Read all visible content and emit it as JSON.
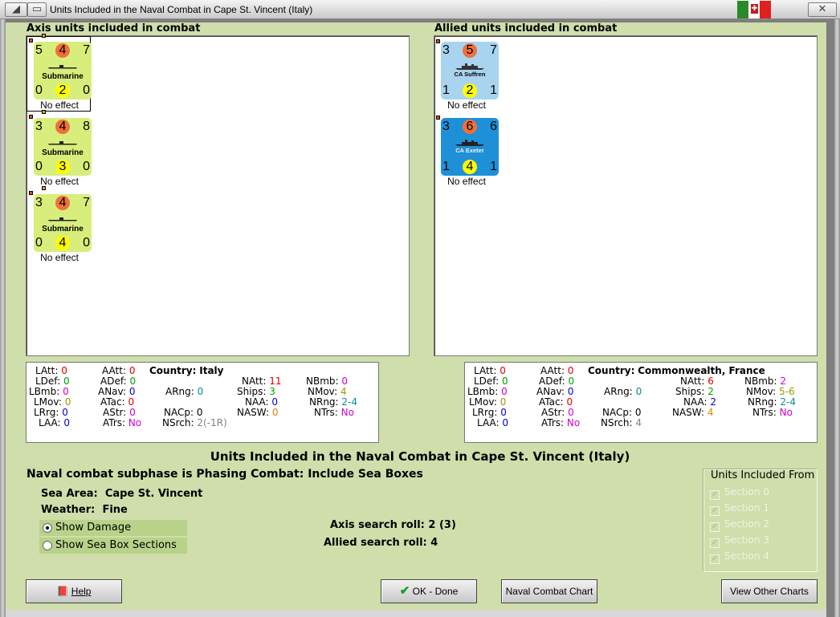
{
  "window": {
    "title": "Units Included in the Naval Combat in Cape St. Vincent (Italy)",
    "flag_colors": [
      "#2a8a2a",
      "#ffffff",
      "#e02020"
    ],
    "close_glyph": "✕"
  },
  "axis": {
    "heading": "Axis units included in combat",
    "units": [
      {
        "name": "Submarine",
        "tl": "5",
        "tc": "4",
        "tr": "7",
        "bl": "0",
        "bc": "2",
        "br": "0",
        "effect": "No effect",
        "color": "#d7ee7c"
      },
      {
        "name": "Submarine",
        "tl": "3",
        "tc": "4",
        "tr": "8",
        "bl": "0",
        "bc": "3",
        "br": "0",
        "effect": "No effect",
        "color": "#d7ee7c"
      },
      {
        "name": "Submarine",
        "tl": "3",
        "tc": "4",
        "tr": "7",
        "bl": "0",
        "bc": "4",
        "br": "0",
        "effect": "No effect",
        "color": "#d7ee7c"
      }
    ],
    "stats": {
      "country_label": "Country:",
      "country": "Italy",
      "LAtt": "0",
      "LDef": "0",
      "LBmb": "0",
      "LMov": "0",
      "LRrg": "0",
      "LAA": "0",
      "AAtt": "0",
      "ADef": "0",
      "ANav": "0",
      "ATac": "0",
      "AStr": "0",
      "ATrs": "No",
      "ARng": "0",
      "NACp": "0",
      "NAtt": "11",
      "Ships": "3",
      "NAA": "0",
      "NASW": "0",
      "NSrch": "2(-1R)",
      "NBmb": "0",
      "NMov": "4",
      "NRng": "2-4",
      "NTrs": "No"
    }
  },
  "allied": {
    "heading": "Allied units included in combat",
    "units": [
      {
        "name": "CA Suffren",
        "tl": "3",
        "tc": "5",
        "tr": "7",
        "bl": "1",
        "bc": "2",
        "br": "1",
        "effect": "No effect",
        "color": "#a8d4f0"
      },
      {
        "name": "CA Exeter",
        "tl": "3",
        "tc": "6",
        "tr": "6",
        "bl": "1",
        "bc": "4",
        "br": "1",
        "effect": "No effect",
        "color": "#1e90d8"
      }
    ],
    "stats": {
      "country_label": "Country:",
      "country": "Commonwealth, France",
      "LAtt": "0",
      "LDef": "0",
      "LBmb": "0",
      "LMov": "0",
      "LRrg": "0",
      "LAA": "0",
      "AAtt": "0",
      "ADef": "0",
      "ANav": "0",
      "ATac": "0",
      "AStr": "0",
      "ATrs": "No",
      "ARng": "0",
      "NACp": "0",
      "NAtt": "6",
      "Ships": "2",
      "NAA": "2",
      "NASW": "4",
      "NSrch": "4",
      "NBmb": "2",
      "NMov": "5-6",
      "NRng": "2-4",
      "NTrs": "No"
    }
  },
  "summary": {
    "title": "Units Included in the Naval Combat in Cape St. Vincent (Italy)",
    "subphase": "Naval combat subphase is Phasing Combat: Include Sea Boxes",
    "sea_area_label": "Sea Area:",
    "sea_area": "Cape St. Vincent",
    "weather_label": "Weather:",
    "weather": "Fine",
    "show_damage": "Show Damage",
    "show_sections": "Show Sea Box Sections",
    "axis_roll_label": "Axis search roll:",
    "axis_roll": "2 (3)",
    "allied_roll_label": "Allied search roll:",
    "allied_roll": "4"
  },
  "sections": {
    "title": "Units Included From",
    "items": [
      "Section 0",
      "Section 1",
      "Section 2",
      "Section 3",
      "Section 4"
    ]
  },
  "buttons": {
    "help": "Help",
    "ok": "OK - Done",
    "naval_chart": "Naval Combat Chart",
    "other_charts": "View Other Charts"
  }
}
